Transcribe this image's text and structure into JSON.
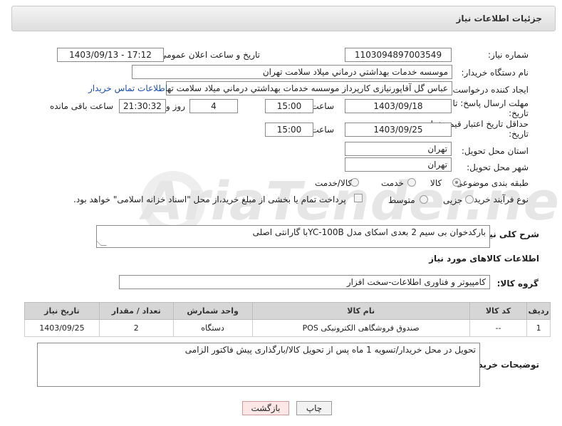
{
  "header": {
    "title": "جزئیات اطلاعات نیاز"
  },
  "fields": {
    "need_number_label": "شماره نیاز:",
    "need_number": "1103094897003549",
    "announce_label": "تاریخ و ساعت اعلان عمومی:",
    "announce_value": "1403/09/13 - 17:12",
    "buyer_org_label": "نام دستگاه خریدار:",
    "buyer_org": "موسسه خدمات بهداشتي درماني ميلاد سلامت تهران",
    "requester_label": "ایجاد کننده درخواست:",
    "requester": "عباس گل آقاپورنیازی کارپرداز موسسه خدمات بهداشتي درماني ميلاد سلامت تهران",
    "buyer_contact_link": "اطلاعات تماس خریدار",
    "deadline_label_line1": "مهلت ارسال پاسخ: تا",
    "deadline_label_line2": "تاریخ:",
    "deadline_date": "1403/09/18",
    "time_label": "ساعت",
    "deadline_time": "15:00",
    "days_value": "4",
    "days_label": "روز و",
    "remaining_time": "21:30:32",
    "remaining_label": "ساعت باقی مانده",
    "validity_label_line1": "حداقل تاریخ اعتبار قیمت: تا",
    "validity_label_line2": "تاریخ:",
    "validity_date": "1403/09/25",
    "validity_time": "15:00",
    "province_label": "استان محل تحویل:",
    "province": "تهران",
    "city_label": "شهر محل تحویل:",
    "city": "تهران",
    "category_label": "طبقه بندی موضوعی:",
    "category_options": [
      "کالا",
      "خدمت",
      "کالا/خدمت"
    ],
    "process_label": "نوع فرآیند خرید :",
    "process_options": [
      "جزیی",
      "متوسط"
    ],
    "payment_note": "پرداخت تمام یا بخشی از مبلغ خرید،از محل \"اسناد خزانه اسلامی\" خواهد بود."
  },
  "summary": {
    "label": "شرح کلی نیاز:",
    "value": "بارکدخوان بی سیم 2 بعدی اسکای مدل YC-100Bبا گارانتی اصلی"
  },
  "goods_section": {
    "title": "اطلاعات کالاهای مورد نیاز"
  },
  "goods_group": {
    "label": "گروه کالا:",
    "value": "کامپیوتر و فناوری اطلاعات-سخت افزار"
  },
  "table": {
    "headers": [
      "ردیف",
      "کد کالا",
      "نام کالا",
      "واحد شمارش",
      "تعداد / مقدار",
      "تاریخ نیاز"
    ],
    "rows": [
      [
        "1",
        "--",
        "صندوق فروشگاهی الکترونیکی POS",
        "دستگاه",
        "2",
        "1403/09/25"
      ]
    ]
  },
  "buyer_notes": {
    "label": "توضیحات خریدار:",
    "value": "تحویل در محل خریدار/تسویه 1 ماه پس از تحویل کالا/بارگذاری پیش فاکتور الزامی"
  },
  "buttons": {
    "print": "چاپ",
    "back": "بازگشت"
  },
  "watermark": {
    "text": "AriaTender.net"
  }
}
